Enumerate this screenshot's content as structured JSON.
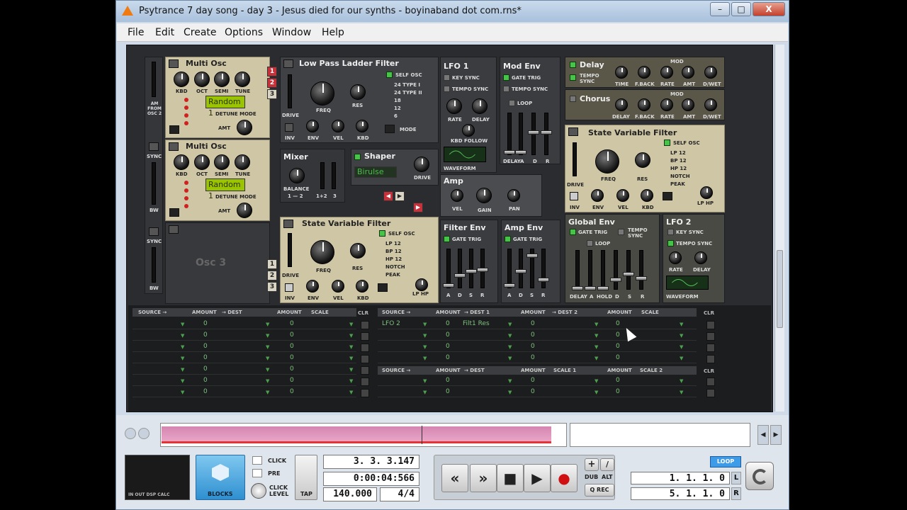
{
  "window": {
    "title": "Psytrance 7 day song - day 3 - Jesus died for our synths - boyinaband dot com.rns*",
    "minimize": "–",
    "maximize": "□",
    "close": "X"
  },
  "menu": [
    "File",
    "Edit",
    "Create",
    "Options",
    "Window",
    "Help"
  ],
  "osc1": {
    "title": "Multi Osc",
    "knobs": [
      "KBD",
      "OCT",
      "SEMI",
      "TUNE"
    ],
    "preset": "Random 1",
    "detune_mode": "DETUNE MODE",
    "amt": "AMT"
  },
  "osc2": {
    "title": "Multi Osc",
    "knobs": [
      "KBD",
      "OCT",
      "SEMI",
      "TUNE"
    ],
    "preset": "Random 1",
    "detune_mode": "DETUNE MODE",
    "amt": "AMT"
  },
  "osc3": {
    "title": "Osc 3"
  },
  "side": {
    "am": "AM FROM OSC 2",
    "sync": "SYNC",
    "bw": "BW",
    "sync2": "SYNC",
    "bw2": "BW"
  },
  "filter1": {
    "title": "Low Pass Ladder Filter",
    "self_osc": "SELF OSC",
    "types": [
      "24 TYPE I",
      "24 TYPE II",
      "18",
      "12",
      "6"
    ],
    "knobs": [
      "FREQ",
      "RES"
    ],
    "drive": "DRIVE",
    "row": [
      "INV",
      "ENV",
      "VEL",
      "KBD"
    ],
    "mode": "MODE",
    "num": [
      "1",
      "2",
      "3"
    ]
  },
  "mixer": {
    "title": "Mixer",
    "balance": "BALANCE",
    "labels": [
      "1 — 2",
      "1+2",
      "3"
    ]
  },
  "shaper": {
    "title": "Shaper",
    "preset": "Birulse",
    "drive": "DRIVE"
  },
  "filter2": {
    "title": "State Variable Filter",
    "self_osc": "SELF OSC",
    "types": [
      "LP 12",
      "BP 12",
      "HP 12",
      "NOTCH",
      "PEAK"
    ],
    "knobs": [
      "FREQ",
      "RES"
    ],
    "drive": "DRIVE",
    "row": [
      "INV",
      "ENV",
      "VEL",
      "KBD"
    ],
    "lphp": "LP    HP",
    "num": [
      "1",
      "2",
      "3"
    ]
  },
  "lfo1": {
    "title": "LFO 1",
    "key_sync": "KEY SYNC",
    "tempo_sync": "TEMPO SYNC",
    "knobs": [
      "RATE",
      "DELAY"
    ],
    "kbd_follow": "KBD FOLLOW",
    "waveform": "WAVEFORM"
  },
  "modenv": {
    "title": "Mod Env",
    "gate": "GATE TRIG",
    "tempo": "TEMPO SYNC",
    "loop": "LOOP",
    "faders": [
      "DELAY",
      "A",
      "D",
      "R"
    ]
  },
  "amp": {
    "title": "Amp",
    "knobs": [
      "VEL",
      "GAIN",
      "PAN"
    ]
  },
  "filterenv": {
    "title": "Filter Env",
    "gate": "GATE TRIG",
    "faders": [
      "A",
      "D",
      "S",
      "R"
    ]
  },
  "ampenv": {
    "title": "Amp Env",
    "gate": "GATE TRIG",
    "faders": [
      "A",
      "D",
      "S",
      "R"
    ]
  },
  "delay": {
    "title": "Delay",
    "tempo": "TEMPO SYNC",
    "knobs": [
      "TIME",
      "F.BACK",
      "RATE",
      "AMT",
      "D/WET"
    ],
    "mod": "MOD"
  },
  "chorus": {
    "title": "Chorus",
    "knobs": [
      "DELAY",
      "F.BACK",
      "RATE",
      "AMT",
      "D/WET"
    ],
    "mod": "MOD"
  },
  "svf3": {
    "title": "State Variable Filter",
    "self_osc": "SELF OSC",
    "types": [
      "LP 12",
      "BP 12",
      "HP 12",
      "NOTCH",
      "PEAK"
    ],
    "knobs": [
      "FREQ",
      "RES"
    ],
    "drive": "DRIVE",
    "row": [
      "INV",
      "ENV",
      "VEL",
      "KBD"
    ],
    "lphp": "LP    HP"
  },
  "globalenv": {
    "title": "Global Env",
    "gate": "GATE TRIG",
    "tempo": "TEMPO SYNC",
    "loop": "LOOP",
    "faders": [
      "DELAY",
      "A",
      "HOLD",
      "D",
      "S",
      "R"
    ]
  },
  "lfo2": {
    "title": "LFO 2",
    "key_sync": "KEY SYNC",
    "tempo_sync": "TEMPO SYNC",
    "knobs": [
      "RATE",
      "DELAY"
    ],
    "waveform": "WAVEFORM"
  },
  "mod1": {
    "headers": [
      "SOURCE →",
      "AMOUNT",
      "→ DEST",
      "AMOUNT",
      "SCALE"
    ],
    "clr": "CLR",
    "zero": "0"
  },
  "mod2": {
    "headers": [
      "SOURCE →",
      "AMOUNT",
      "→ DEST 1",
      "AMOUNT",
      "→ DEST 2",
      "AMOUNT",
      "SCALE"
    ],
    "clr": "CLR",
    "row1_source": "LFO 2",
    "row1_dest": "Filt1 Res",
    "zero": "0"
  },
  "mod3": {
    "headers": [
      "SOURCE →",
      "AMOUNT",
      "→ DEST",
      "AMOUNT",
      "SCALE 1",
      "AMOUNT",
      "SCALE 2"
    ],
    "clr": "CLR",
    "zero": "0"
  },
  "transport": {
    "blocks": "BLOCKS",
    "dsp": "IN  OUT  DSP  CALC",
    "click": "CLICK",
    "pre": "PRE",
    "click_level": "CLICK LEVEL",
    "tap": "TAP",
    "position": "3. 3. 3.147",
    "time": "0:00:04:566",
    "tempo": "140.000",
    "signature": "4/4",
    "dub": "DUB",
    "alt": "ALT",
    "qrec": "Q REC",
    "loop": "LOOP",
    "left_locator": "1. 1. 1.   0",
    "right_locator": "5. 1. 1.   0",
    "l": "L",
    "r": "R"
  }
}
